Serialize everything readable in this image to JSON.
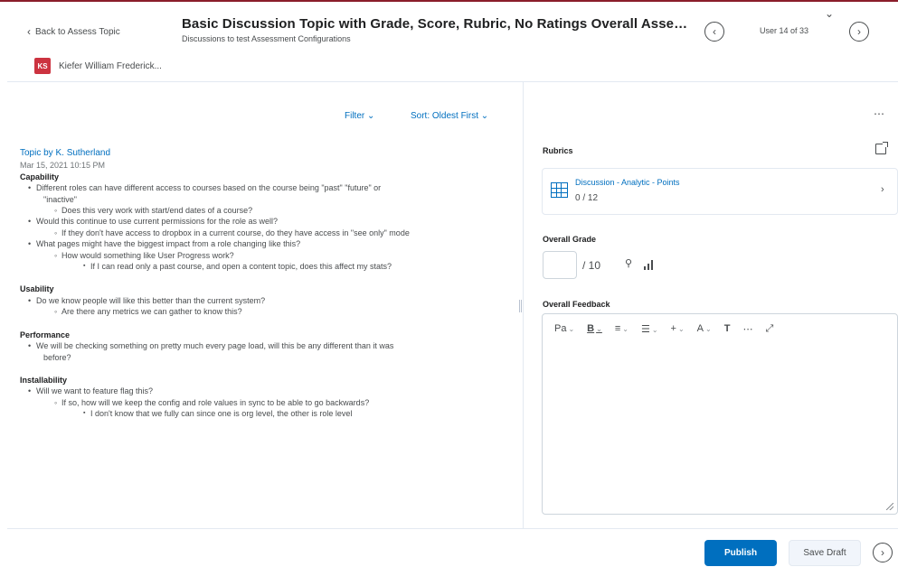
{
  "header": {
    "back_label": "Back to Assess Topic",
    "title": "Basic Discussion Topic with Grade, Score, Rubric, No Ratings Overall Assessm...",
    "subtitle": "Discussions to test Assessment Configurations",
    "user_count": "User 14 of 33",
    "icons": {
      "back": "chevron-left-icon",
      "prev": "chevron-left-circle-icon",
      "next": "chevron-right-circle-icon",
      "collapse": "chevron-down-icon"
    }
  },
  "user": {
    "initials": "KS",
    "name": "Kiefer William Frederick...",
    "avatar_color": "#cc3340"
  },
  "discussion": {
    "filter_label": "Filter",
    "sort_label": "Sort: Oldest First",
    "author": "Topic by K. Sutherland",
    "date": "Mar 15, 2021 10:15 PM",
    "sections": [
      {
        "heading": "Capability",
        "items": [
          {
            "level": 1,
            "text": "Different roles can have different access to courses based on the course being \"past\" \"future\" or"
          },
          {
            "level": 0,
            "text": "\"inactive\""
          },
          {
            "level": 2,
            "text": "Does this very work with start/end dates of a course?"
          },
          {
            "level": 1,
            "text": "Would this continue to use current permissions for the role as well?"
          },
          {
            "level": 2,
            "text": "If they don't have access to dropbox in a current course, do they have access in \"see only\" mode"
          },
          {
            "level": 1,
            "text": "What pages might have the biggest impact from a role changing like this?"
          },
          {
            "level": 2,
            "text": "How would something like User Progress work?"
          },
          {
            "level": 3,
            "text": "If I can read only a past course, and open a content topic, does this affect my stats?"
          }
        ]
      },
      {
        "heading": "Usability",
        "items": [
          {
            "level": 1,
            "text": "Do we know people will like this better than the current system?"
          },
          {
            "level": 2,
            "text": "Are there any metrics we can gather to know this?"
          }
        ]
      },
      {
        "heading": "Performance",
        "items": [
          {
            "level": 1,
            "text": "We will be checking something on pretty much every page load, will this be any different than it was"
          },
          {
            "level": 0,
            "text": "before?"
          }
        ]
      },
      {
        "heading": "Installability",
        "items": [
          {
            "level": 1,
            "text": "Will we want to feature flag this?"
          },
          {
            "level": 2,
            "text": "If so, how will we keep the config and role values in sync to be able to go backwards?"
          },
          {
            "level": 3,
            "text": "I don't know that we fully can since one is org level, the other is role level"
          }
        ]
      }
    ]
  },
  "assessment": {
    "more_label": "⋯",
    "rubrics_label": "Rubrics",
    "rubric": {
      "name": "Discussion - Analytic - Points",
      "score": "0 / 12"
    },
    "overall_grade_label": "Overall Grade",
    "grade_value": "",
    "grade_out_of": "/ 10",
    "overall_feedback_label": "Overall Feedback",
    "toolbar": {
      "format": "Pa",
      "bold": "B",
      "align": "≡",
      "list": "☰",
      "insert": "+",
      "font": "A",
      "clear_format": "T",
      "more": "⋯",
      "fullscreen": "⤢"
    },
    "feedback_value": ""
  },
  "footer": {
    "publish_label": "Publish",
    "save_draft_label": "Save Draft"
  },
  "colors": {
    "primary": "#006fbf",
    "text": "#202122",
    "muted": "#494c4e",
    "border": "#cdd5dc",
    "top_line": "#8a1e2a"
  }
}
